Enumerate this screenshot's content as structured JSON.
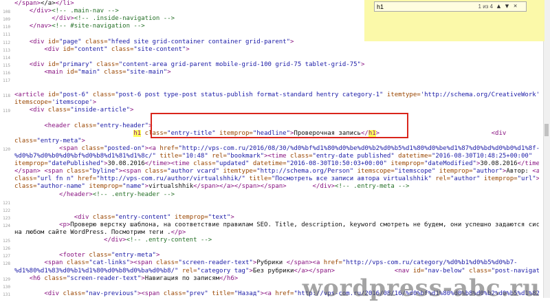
{
  "find_bar": {
    "query": "h1",
    "match_count": "1 из 4",
    "prev_icon": "chevron-up-icon",
    "next_icon": "chevron-down-icon",
    "close_icon": "close-icon"
  },
  "watermark": "wordpress-abc.ru",
  "colors": {
    "find_bar_bg": "#fbf9a9",
    "highlight": "#ffff5a",
    "selection_box": "#d9251b",
    "tag": "#881280",
    "attribute_name": "#994500",
    "attribute_value": "#1a1aa6",
    "comment": "#236e25"
  },
  "code_lines": [
    {
      "n": "",
      "segs": [
        [
          "t",
          "</span>"
        ],
        [
          "x",
          "</a>"
        ],
        [
          "t",
          "</li>"
        ]
      ]
    },
    {
      "n": "108",
      "segs": [
        [
          "x",
          "    "
        ],
        [
          "t",
          "</div>"
        ],
        [
          "c",
          "<!-- .main-nav -->"
        ]
      ]
    },
    {
      "n": "109",
      "segs": [
        [
          "x",
          "          "
        ],
        [
          "t",
          "</div>"
        ],
        [
          "c",
          "<!-- .inside-navigation -->"
        ]
      ]
    },
    {
      "n": "110",
      "segs": [
        [
          "x",
          "    "
        ],
        [
          "t",
          "</nav>"
        ],
        [
          "c",
          "<!-- #site-navigation -->"
        ]
      ]
    },
    {
      "n": "111",
      "segs": []
    },
    {
      "n": "112",
      "segs": [
        [
          "x",
          "    "
        ],
        [
          "t",
          "<div "
        ],
        [
          "a",
          "id="
        ],
        [
          "v",
          "\"page\" "
        ],
        [
          "a",
          "class="
        ],
        [
          "v",
          "\"hfeed site grid-container container grid-parent\""
        ],
        [
          "t",
          ">"
        ]
      ]
    },
    {
      "n": "113",
      "segs": [
        [
          "x",
          "        "
        ],
        [
          "t",
          "<div "
        ],
        [
          "a",
          "id="
        ],
        [
          "v",
          "\"content\" "
        ],
        [
          "a",
          "class="
        ],
        [
          "v",
          "\"site-content\""
        ],
        [
          "t",
          ">"
        ]
      ]
    },
    {
      "n": "114",
      "segs": []
    },
    {
      "n": "115",
      "segs": [
        [
          "x",
          "    "
        ],
        [
          "t",
          "<div "
        ],
        [
          "a",
          "id="
        ],
        [
          "v",
          "\"primary\" "
        ],
        [
          "a",
          "class="
        ],
        [
          "v",
          "\"content-area grid-parent mobile-grid-100 grid-75 tablet-grid-75\""
        ],
        [
          "t",
          ">"
        ]
      ]
    },
    {
      "n": "116",
      "segs": [
        [
          "x",
          "        "
        ],
        [
          "t",
          "<main "
        ],
        [
          "a",
          "id="
        ],
        [
          "v",
          "\"main\" "
        ],
        [
          "a",
          "class="
        ],
        [
          "v",
          "\"site-main\""
        ],
        [
          "t",
          ">"
        ]
      ]
    },
    {
      "n": "117",
      "segs": []
    },
    {
      "n": "",
      "segs": []
    },
    {
      "n": "118",
      "segs": [
        [
          "t",
          "<article "
        ],
        [
          "a",
          "id="
        ],
        [
          "v",
          "\"post-6\" "
        ],
        [
          "a",
          "class="
        ],
        [
          "v",
          "\"post-6 post type-post status-publish format-standard hentry category-1\" "
        ],
        [
          "a",
          "itemtype="
        ],
        [
          "v",
          "'http://schema.org/CreativeWork' "
        ]
      ]
    },
    {
      "n": "",
      "segs": [
        [
          "a",
          "itemscope="
        ],
        [
          "v",
          "'itemscope'"
        ],
        [
          "t",
          ">"
        ]
      ]
    },
    {
      "n": "119",
      "segs": [
        [
          "x",
          "    "
        ],
        [
          "t",
          "<div "
        ],
        [
          "a",
          "class="
        ],
        [
          "v",
          "\"inside-article\""
        ],
        [
          "t",
          ">"
        ]
      ]
    },
    {
      "n": "",
      "segs": []
    },
    {
      "n": "",
      "segs": [
        [
          "x",
          "        "
        ],
        [
          "t",
          "<header "
        ],
        [
          "a",
          "class="
        ],
        [
          "v",
          "\"entry-header\""
        ],
        [
          "t",
          ">"
        ]
      ]
    },
    {
      "n": "",
      "segs": [
        [
          "x",
          "                                "
        ],
        [
          "hl",
          "h1"
        ],
        [
          "t",
          " "
        ],
        [
          "a",
          "class="
        ],
        [
          "v",
          "\"entry-title\" "
        ],
        [
          "a",
          "itemprop="
        ],
        [
          "v",
          "\"headline\""
        ],
        [
          "t",
          ">"
        ],
        [
          "x",
          "Проверочная запись"
        ],
        [
          "t",
          "</"
        ],
        [
          "hl",
          "h1"
        ],
        [
          "t",
          ">"
        ],
        [
          "x",
          "                              "
        ],
        [
          "t",
          "<div"
        ]
      ]
    },
    {
      "n": "",
      "segs": [
        [
          "a",
          "class="
        ],
        [
          "v",
          "\"entry-meta\""
        ],
        [
          "t",
          ">"
        ]
      ]
    },
    {
      "n": "120",
      "segs": [
        [
          "x",
          "            "
        ],
        [
          "t",
          "<span "
        ],
        [
          "a",
          "class="
        ],
        [
          "v",
          "\"posted-on\""
        ],
        [
          "t",
          "><a "
        ],
        [
          "a",
          "href="
        ],
        [
          "v",
          "\"http://vps-com.ru/2016/08/30/%d0%bf%d1%80%d0%be%d0%b2%d0%b5%d1%80%d0%be%d1%87%d0%bd%d0%b0%d1%8f-"
        ]
      ]
    },
    {
      "n": "",
      "segs": [
        [
          "v",
          "%d0%b7%d0%b0%d0%bf%d0%b8%d1%81%d1%8c/\" "
        ],
        [
          "a",
          "title="
        ],
        [
          "v",
          "\"10:48\" "
        ],
        [
          "a",
          "rel="
        ],
        [
          "v",
          "\"bookmark\""
        ],
        [
          "t",
          "><time "
        ],
        [
          "a",
          "class="
        ],
        [
          "v",
          "\"entry-date published\" "
        ],
        [
          "a",
          "datetime="
        ],
        [
          "v",
          "\"2016-08-30T10:48:25+00:00\""
        ]
      ]
    },
    {
      "n": "",
      "segs": [
        [
          "a",
          "itemprop="
        ],
        [
          "v",
          "\"datePublished\""
        ],
        [
          "t",
          ">"
        ],
        [
          "x",
          "30.08.2016"
        ],
        [
          "t",
          "</time><time "
        ],
        [
          "a",
          "class="
        ],
        [
          "v",
          "\"updated\" "
        ],
        [
          "a",
          "datetime="
        ],
        [
          "v",
          "\"2016-08-30T10:50:03+00:00\" "
        ],
        [
          "a",
          "itemprop="
        ],
        [
          "v",
          "\"dateModified\""
        ],
        [
          "t",
          ">"
        ],
        [
          "x",
          "30.08.2016"
        ],
        [
          "t",
          "</time></a>"
        ]
      ]
    },
    {
      "n": "",
      "segs": [
        [
          "t",
          "</span> <span "
        ],
        [
          "a",
          "class="
        ],
        [
          "v",
          "\"byline\""
        ],
        [
          "t",
          "><span "
        ],
        [
          "a",
          "class="
        ],
        [
          "v",
          "\"author vcard\" "
        ],
        [
          "a",
          "itemtype="
        ],
        [
          "v",
          "\"http://schema.org/Person\" "
        ],
        [
          "a",
          "itemscope="
        ],
        [
          "v",
          "\"itemscope\" "
        ],
        [
          "a",
          "itemprop="
        ],
        [
          "v",
          "\"author\""
        ],
        [
          "t",
          ">"
        ],
        [
          "x",
          "Автор: "
        ],
        [
          "t",
          "<a"
        ]
      ]
    },
    {
      "n": "",
      "segs": [
        [
          "a",
          "class="
        ],
        [
          "v",
          "\"url fn n\" "
        ],
        [
          "a",
          "href="
        ],
        [
          "v",
          "\"http://vps-com.ru/author/virtualshhik/\" "
        ],
        [
          "a",
          "title="
        ],
        [
          "v",
          "\"Посмотреть все записи автора virtualshhik\" "
        ],
        [
          "a",
          "rel="
        ],
        [
          "v",
          "\"author\" "
        ],
        [
          "a",
          "itemprop="
        ],
        [
          "v",
          "\"url\""
        ],
        [
          "t",
          "><span"
        ]
      ]
    },
    {
      "n": "",
      "segs": [
        [
          "a",
          "class="
        ],
        [
          "v",
          "\"author-name\" "
        ],
        [
          "a",
          "itemprop="
        ],
        [
          "v",
          "\"name\""
        ],
        [
          "t",
          ">"
        ],
        [
          "x",
          "virtualshhik"
        ],
        [
          "t",
          "</span></a></span></span>"
        ],
        [
          "x",
          "       "
        ],
        [
          "t",
          "</div>"
        ],
        [
          "c",
          "<!-- .entry-meta -->"
        ]
      ]
    },
    {
      "n": "",
      "segs": [
        [
          "x",
          "            "
        ],
        [
          "t",
          "</header>"
        ],
        [
          "c",
          "<!-- .entry-header -->"
        ]
      ]
    },
    {
      "n": "121",
      "segs": []
    },
    {
      "n": "122",
      "segs": []
    },
    {
      "n": "123",
      "segs": [
        [
          "x",
          "                "
        ],
        [
          "t",
          "<div "
        ],
        [
          "a",
          "class="
        ],
        [
          "v",
          "\"entry-content\" "
        ],
        [
          "a",
          "itemprop="
        ],
        [
          "v",
          "\"text\""
        ],
        [
          "t",
          ">"
        ]
      ]
    },
    {
      "n": "124",
      "segs": [
        [
          "x",
          "            "
        ],
        [
          "t",
          "<p>"
        ],
        [
          "x",
          "Проверю верстку шаблона, на соответствие правилам SEO. Title, description, keyword смотреть не будем, они успешно задаются системой"
        ]
      ]
    },
    {
      "n": "",
      "segs": [
        [
          "x",
          "на любом сайте WordPress. Посмотрим теги ."
        ],
        [
          "t",
          "</p>"
        ]
      ]
    },
    {
      "n": "125",
      "segs": [
        [
          "x",
          "                        "
        ],
        [
          "t",
          "</div>"
        ],
        [
          "c",
          "<!-- .entry-content -->"
        ]
      ]
    },
    {
      "n": "126",
      "segs": []
    },
    {
      "n": "127",
      "segs": [
        [
          "x",
          "            "
        ],
        [
          "t",
          "<footer "
        ],
        [
          "a",
          "class="
        ],
        [
          "v",
          "\"entry-meta\""
        ],
        [
          "t",
          ">"
        ]
      ]
    },
    {
      "n": "128",
      "segs": [
        [
          "x",
          "        "
        ],
        [
          "t",
          "<span "
        ],
        [
          "a",
          "class="
        ],
        [
          "v",
          "\"cat-links\""
        ],
        [
          "t",
          "><span "
        ],
        [
          "a",
          "class="
        ],
        [
          "v",
          "\"screen-reader-text\""
        ],
        [
          "t",
          ">"
        ],
        [
          "x",
          "Рубрики "
        ],
        [
          "t",
          "</span><a "
        ],
        [
          "a",
          "href="
        ],
        [
          "v",
          "\"http://vps-com.ru/category/%d0%b1%d0%b5%d0%b7-"
        ]
      ]
    },
    {
      "n": "",
      "segs": [
        [
          "v",
          "%d1%80%d1%83%d0%b1%d1%80%d0%b8%d0%ba%d0%b8/\" "
        ],
        [
          "a",
          "rel="
        ],
        [
          "v",
          "\"category tag\""
        ],
        [
          "t",
          ">"
        ],
        [
          "x",
          "Без рубрики"
        ],
        [
          "t",
          "</a></span>"
        ],
        [
          "x",
          "                "
        ],
        [
          "t",
          "<nav "
        ],
        [
          "a",
          "id="
        ],
        [
          "v",
          "\"nav-below\" "
        ],
        [
          "a",
          "class="
        ],
        [
          "v",
          "\"post-navigation\""
        ],
        [
          "t",
          ">"
        ]
      ]
    },
    {
      "n": "129",
      "segs": [
        [
          "x",
          "    "
        ],
        [
          "t",
          "<h6 "
        ],
        [
          "a",
          "class="
        ],
        [
          "v",
          "\"screen-reader-text\""
        ],
        [
          "t",
          ">"
        ],
        [
          "x",
          "Навигация по записям"
        ],
        [
          "t",
          "</h6>"
        ]
      ]
    },
    {
      "n": "130",
      "segs": []
    },
    {
      "n": "131",
      "segs": [
        [
          "x",
          "        "
        ],
        [
          "t",
          "<div "
        ],
        [
          "a",
          "class="
        ],
        [
          "v",
          "\"nav-previous\""
        ],
        [
          "t",
          "><span "
        ],
        [
          "a",
          "class="
        ],
        [
          "v",
          "\"prev\" "
        ],
        [
          "a",
          "title="
        ],
        [
          "v",
          "\"Назад\""
        ],
        [
          "t",
          "><a "
        ],
        [
          "a",
          "href="
        ],
        [
          "v",
          "\"http://vps-com.ru/2016/08/16/%d0%bf%d1%80%d0%b8%d0%b2%d0%b5%d1%82-"
        ]
      ]
    },
    {
      "n": "",
      "segs": [
        [
          "v",
          "%d0%bc%d0%b8%d1%80/\" "
        ],
        [
          "a",
          "rel="
        ],
        [
          "v",
          "\"prev\""
        ],
        [
          "t",
          ">"
        ],
        [
          "x",
          "Привет, мир!"
        ],
        [
          "t",
          "</a></span></div>"
        ]
      ]
    }
  ]
}
